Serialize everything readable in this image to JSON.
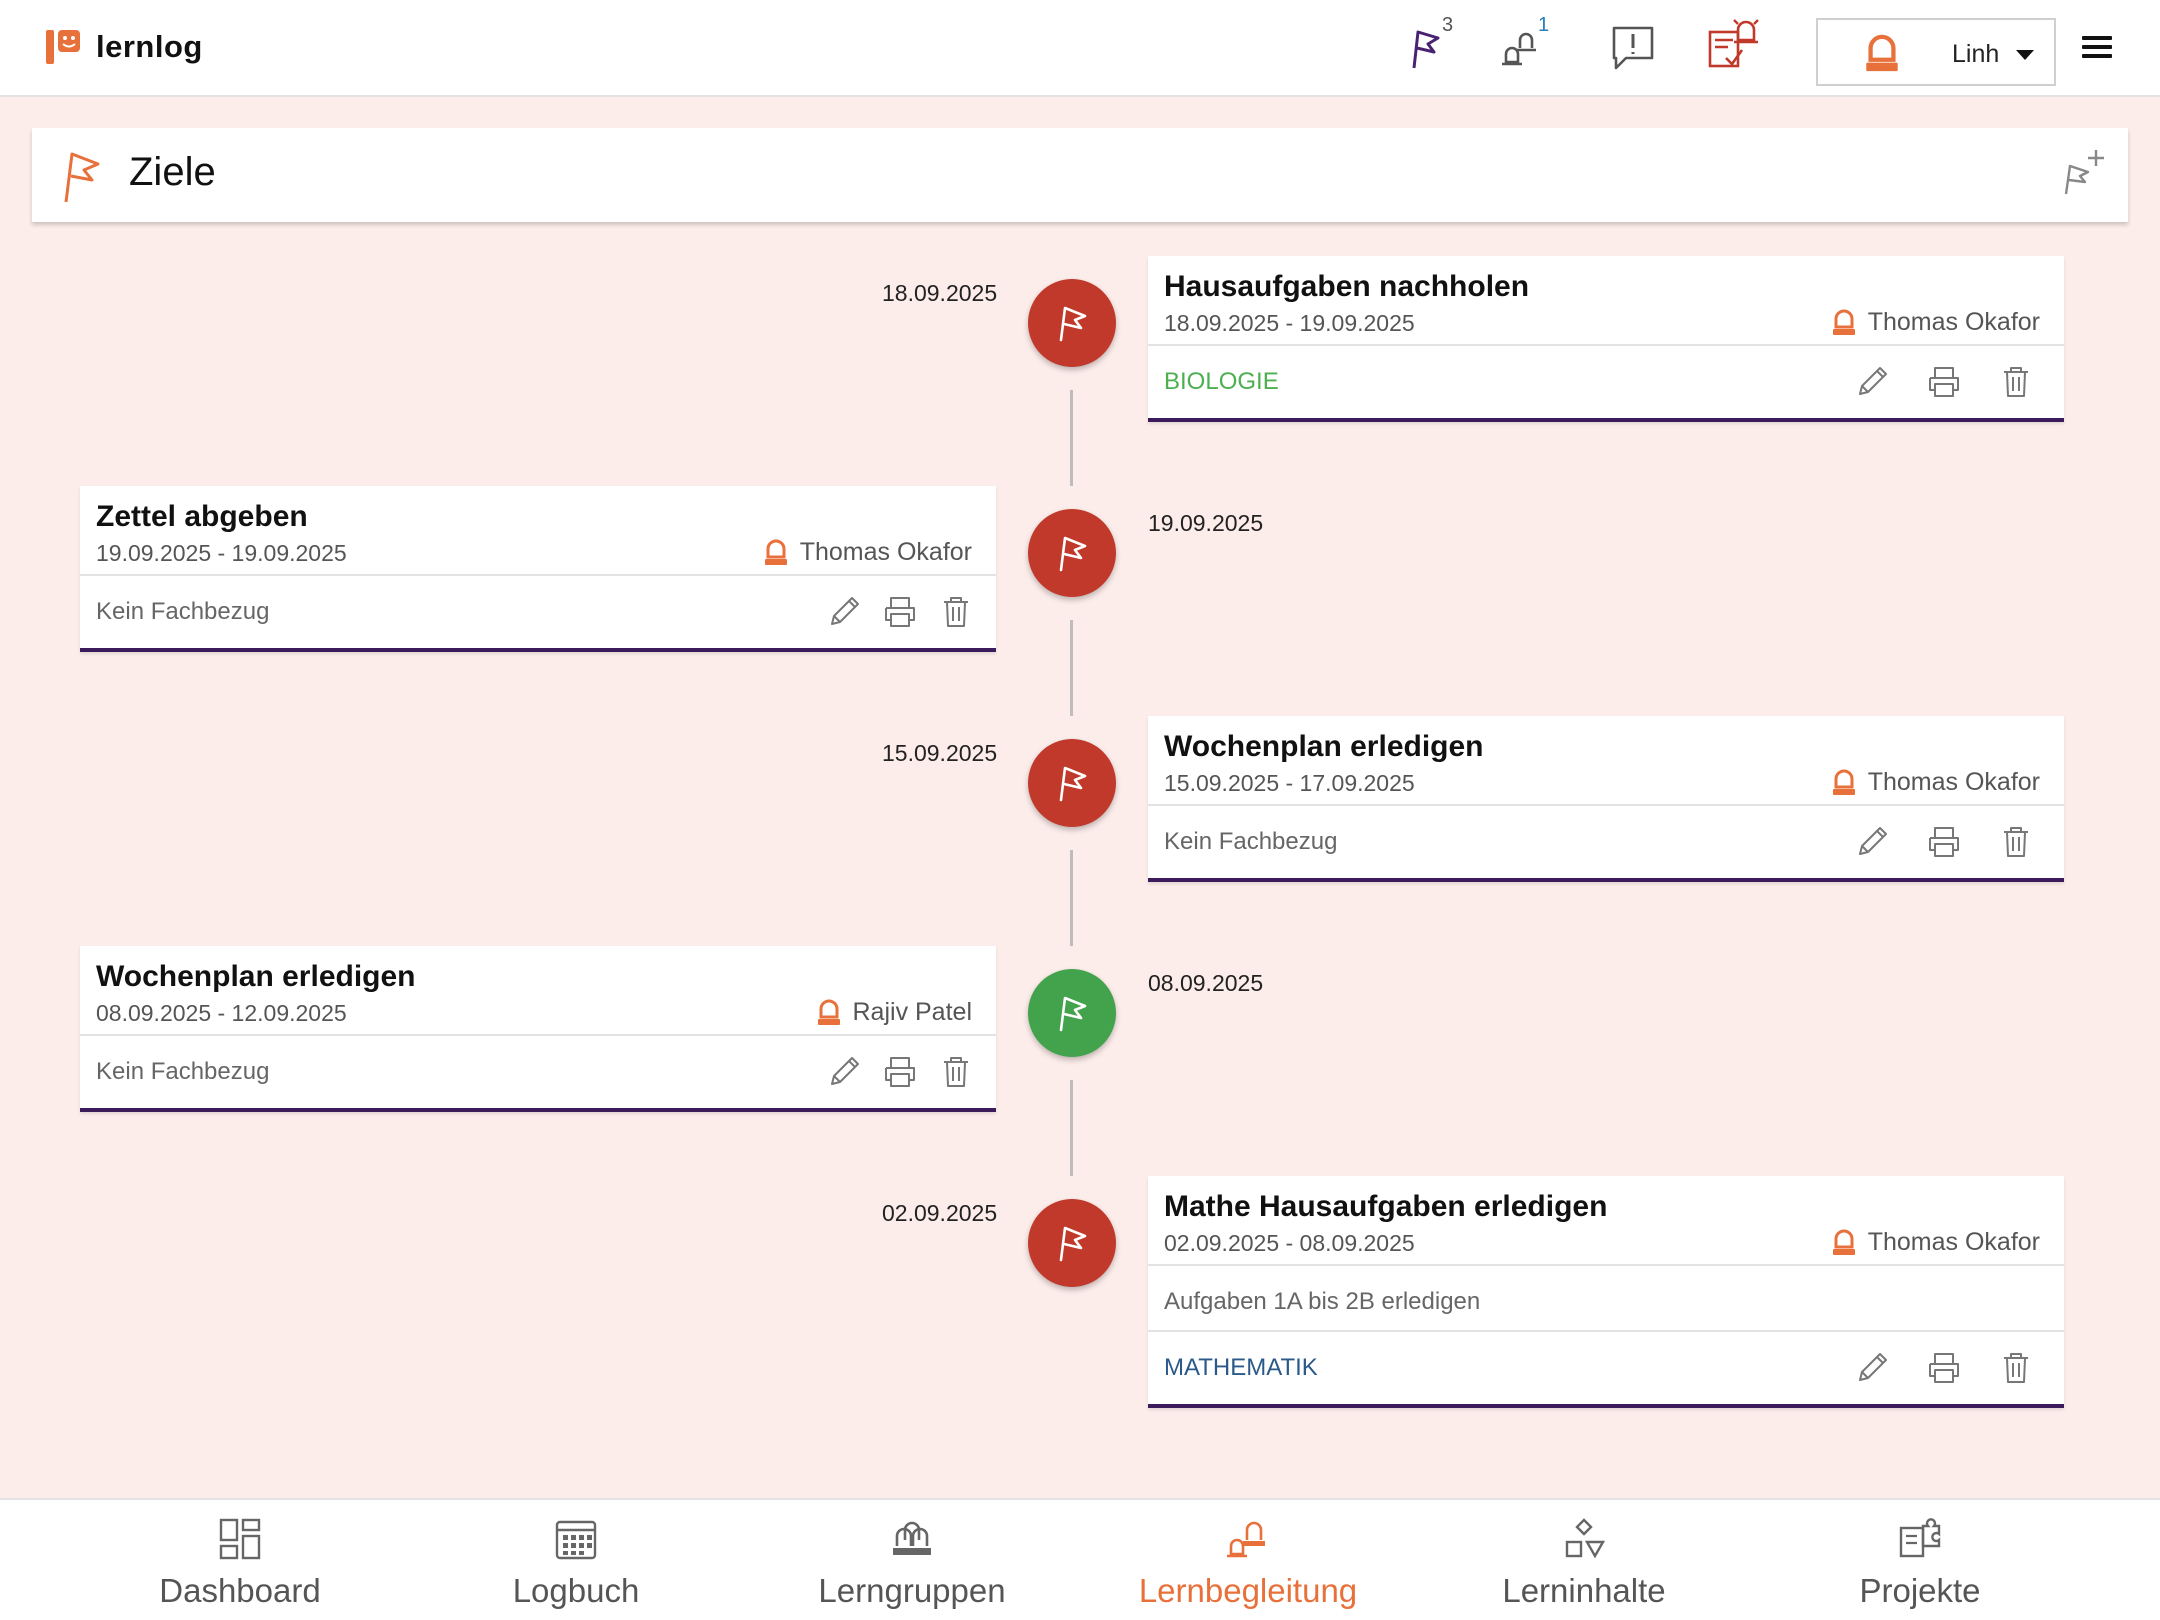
{
  "app": {
    "name": "lernlog"
  },
  "topbar": {
    "goals_badge": "3",
    "mentoring_badge": "1",
    "user_name": "Linh"
  },
  "page": {
    "title": "Ziele"
  },
  "goals": [
    {
      "date": "18.09.2025",
      "title": "Hausaufgaben nachholen",
      "range": "18.09.2025 - 19.09.2025",
      "owner": "Thomas Okafor",
      "description": "",
      "subject": "BIOLOGIE",
      "status": "red"
    },
    {
      "date": "19.09.2025",
      "title": "Zettel abgeben",
      "range": "19.09.2025 - 19.09.2025",
      "owner": "Thomas Okafor",
      "description": "",
      "subject": "Kein Fachbezug",
      "status": "red"
    },
    {
      "date": "15.09.2025",
      "title": "Wochenplan erledigen",
      "range": "15.09.2025 - 17.09.2025",
      "owner": "Thomas Okafor",
      "description": "",
      "subject": "Kein Fachbezug",
      "status": "red"
    },
    {
      "date": "08.09.2025",
      "title": "Wochenplan erledigen",
      "range": "08.09.2025 - 12.09.2025",
      "owner": "Rajiv Patel",
      "description": "",
      "subject": "Kein Fachbezug",
      "status": "green"
    },
    {
      "date": "02.09.2025",
      "title": "Mathe Hausaufgaben erledigen",
      "range": "02.09.2025 - 08.09.2025",
      "owner": "Thomas Okafor",
      "description": "Aufgaben 1A bis 2B erledigen",
      "subject": "MATHEMATIK",
      "status": "red"
    }
  ],
  "colors": {
    "accent": "#e8703a",
    "status_red": "#c0392b",
    "status_green": "#43a24c",
    "subject_biologie": "#4caf50",
    "subject_mathematik": "#2b5a8a",
    "subject_none": "#666666",
    "card_border": "#3b1b5c",
    "background": "#fcedea"
  },
  "bottomnav": {
    "items": [
      {
        "label": "Dashboard",
        "icon": "dashboard-icon"
      },
      {
        "label": "Logbuch",
        "icon": "calendar-icon"
      },
      {
        "label": "Lerngruppen",
        "icon": "group-icon"
      },
      {
        "label": "Lernbegleitung",
        "icon": "mentoring-icon",
        "active": true
      },
      {
        "label": "Lerninhalte",
        "icon": "shapes-icon"
      },
      {
        "label": "Projekte",
        "icon": "puzzle-icon"
      }
    ]
  }
}
